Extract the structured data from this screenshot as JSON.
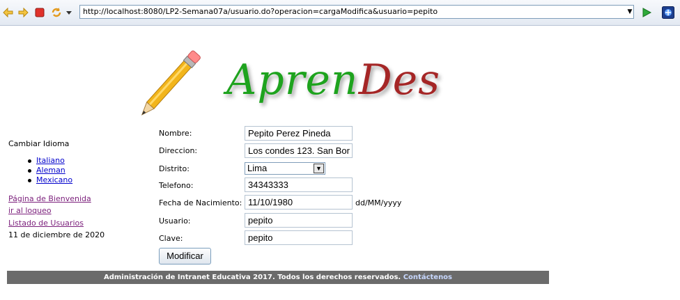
{
  "browser": {
    "url": "http://localhost:8080/LP2-Semana07a/usuario.do?operacion=cargaModifica&usuario=pepito",
    "icons": [
      "back-icon",
      "forward-icon",
      "stop-icon",
      "refresh-icon",
      "dropdown-icon",
      "go-icon",
      "extension-icon"
    ]
  },
  "logo": {
    "part1": "Apren",
    "part2": "Des",
    "colors": {
      "part1": "#1ea31e",
      "part2": "#a52626"
    }
  },
  "sidebar": {
    "language_title": "Cambiar Idioma",
    "languages": [
      "Italiano",
      "Aleman",
      "Mexicano"
    ],
    "links": [
      "Página de Bienvenida",
      "ir al loqueo",
      "Listado de Usuarios"
    ],
    "date": "11 de diciembre de 2020"
  },
  "form": {
    "nombre_label": "Nombre:",
    "nombre_value": "Pepito Perez Pineda",
    "direccion_label": "Direccion:",
    "direccion_value": "Los condes 123. San Bor",
    "distrito_label": "Distrito:",
    "distrito_value": "Lima",
    "telefono_label": "Telefono:",
    "telefono_value": "34343333",
    "fecha_label": "Fecha de Nacimiento:",
    "fecha_value": "11/10/1980",
    "fecha_hint": "dd/MM/yyyy",
    "usuario_label": "Usuario:",
    "usuario_value": "pepito",
    "clave_label": "Clave:",
    "clave_value": "pepito",
    "submit_label": "Modificar"
  },
  "footer": {
    "text": "Administración de Intranet Educativa 2017. Todos los derechos reservados.",
    "link": "Contáctenos"
  }
}
